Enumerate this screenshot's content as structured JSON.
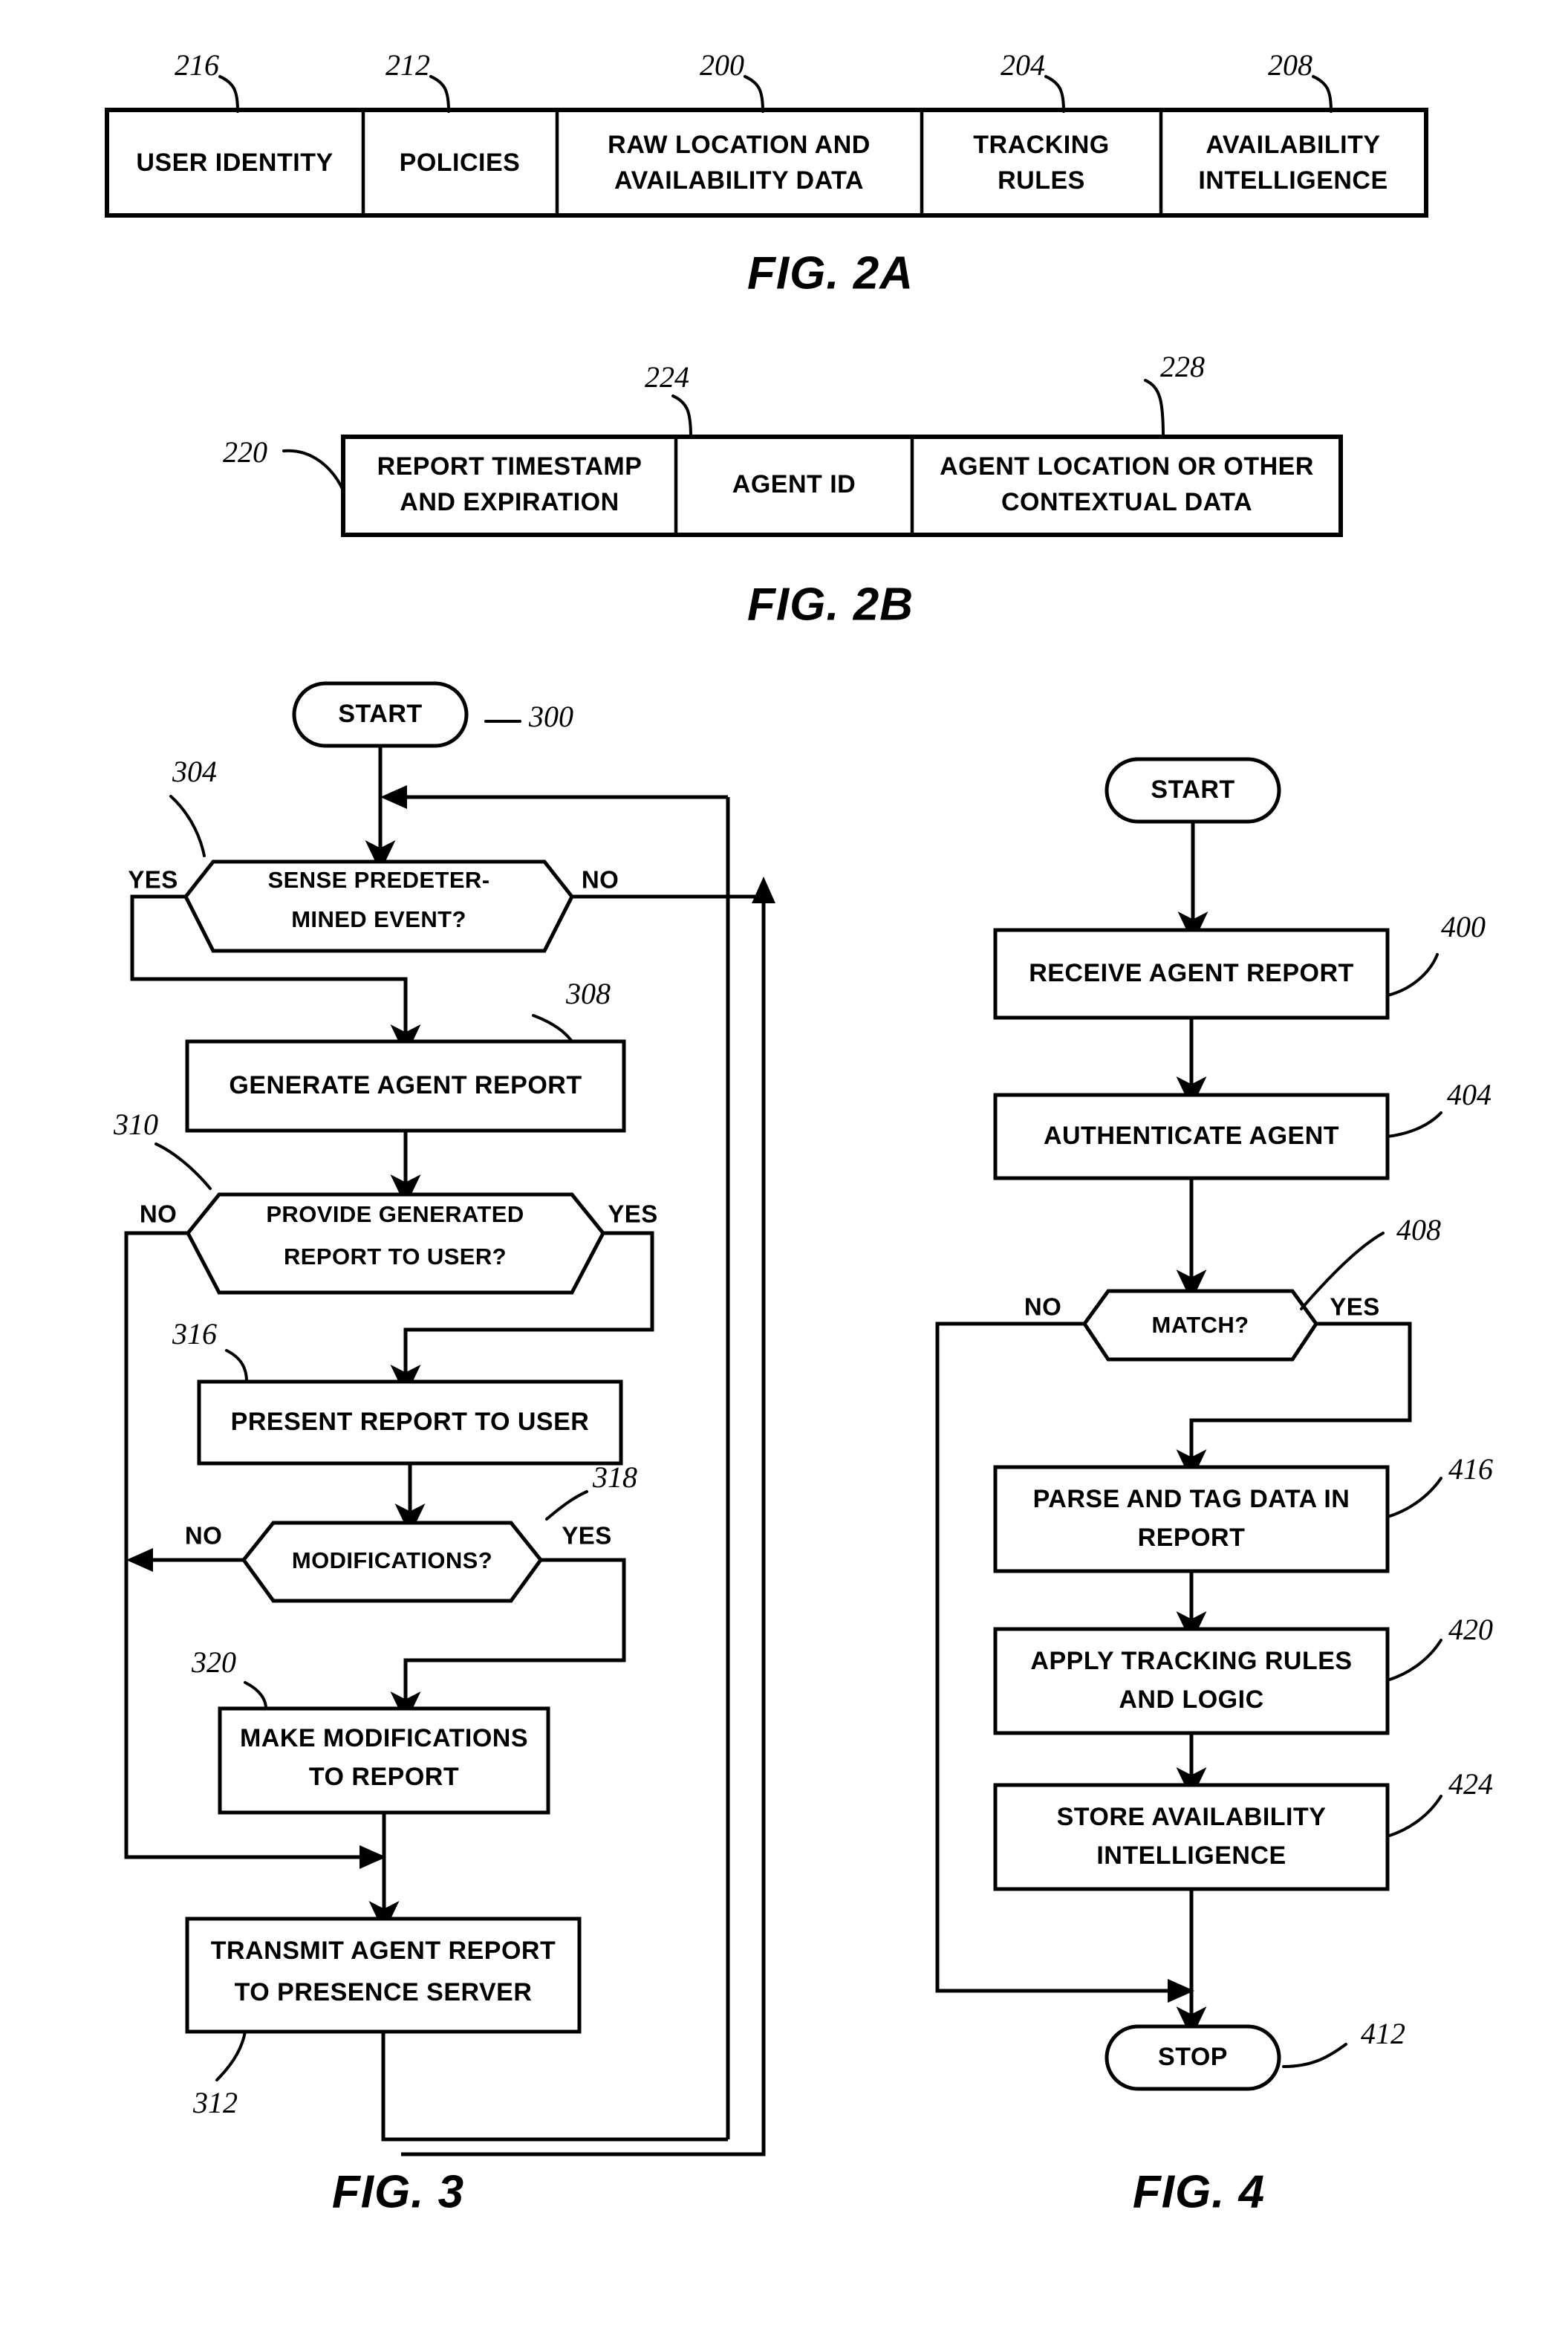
{
  "figures": {
    "fig2a": {
      "label": "FIG. 2A",
      "cells": [
        {
          "text": [
            "USER IDENTITY"
          ],
          "ref": "216"
        },
        {
          "text": [
            "POLICIES"
          ],
          "ref": "212"
        },
        {
          "text": [
            "RAW LOCATION AND",
            "AVAILABILITY DATA"
          ],
          "ref": "200"
        },
        {
          "text": [
            "TRACKING",
            "RULES"
          ],
          "ref": "204"
        },
        {
          "text": [
            "AVAILABILITY",
            "INTELLIGENCE"
          ],
          "ref": "208"
        }
      ]
    },
    "fig2b": {
      "label": "FIG. 2B",
      "row_ref": "220",
      "cells": [
        {
          "text": [
            "REPORT TIMESTAMP",
            "AND EXPIRATION"
          ],
          "ref": ""
        },
        {
          "text": [
            "AGENT ID"
          ],
          "ref": "224"
        },
        {
          "text": [
            "AGENT LOCATION OR OTHER",
            "CONTEXTUAL DATA"
          ],
          "ref": "228"
        }
      ]
    },
    "fig3": {
      "label": "FIG. 3",
      "nodes": [
        {
          "id": "start",
          "kind": "terminator",
          "text": [
            "START"
          ],
          "ref": "300"
        },
        {
          "id": "sense",
          "kind": "decision",
          "text": [
            "SENSE PREDETER-",
            "MINED EVENT?"
          ],
          "ref": "304",
          "yes": "YES",
          "no": "NO"
        },
        {
          "id": "generate",
          "kind": "process",
          "text": [
            "GENERATE AGENT REPORT"
          ],
          "ref": "308"
        },
        {
          "id": "provide",
          "kind": "decision",
          "text": [
            "PROVIDE GENERATED",
            "REPORT TO USER?"
          ],
          "ref": "310",
          "yes": "YES",
          "no": "NO"
        },
        {
          "id": "present",
          "kind": "process",
          "text": [
            "PRESENT REPORT TO USER"
          ],
          "ref": "316"
        },
        {
          "id": "modifications",
          "kind": "decision",
          "text": [
            "MODIFICATIONS?"
          ],
          "ref": "318",
          "yes": "YES",
          "no": "NO"
        },
        {
          "id": "make",
          "kind": "process",
          "text": [
            "MAKE MODIFICATIONS",
            "TO REPORT"
          ],
          "ref": "320"
        },
        {
          "id": "transmit",
          "kind": "process",
          "text": [
            "TRANSMIT AGENT REPORT",
            "TO PRESENCE SERVER"
          ],
          "ref": "312"
        }
      ]
    },
    "fig4": {
      "label": "FIG. 4",
      "nodes": [
        {
          "id": "start",
          "kind": "terminator",
          "text": [
            "START"
          ],
          "ref": ""
        },
        {
          "id": "receive",
          "kind": "process",
          "text": [
            "RECEIVE AGENT REPORT"
          ],
          "ref": "400"
        },
        {
          "id": "authenticate",
          "kind": "process",
          "text": [
            "AUTHENTICATE AGENT"
          ],
          "ref": "404"
        },
        {
          "id": "match",
          "kind": "decision",
          "text": [
            "MATCH?"
          ],
          "ref": "408",
          "yes": "YES",
          "no": "NO"
        },
        {
          "id": "parse",
          "kind": "process",
          "text": [
            "PARSE AND TAG DATA IN",
            "REPORT"
          ],
          "ref": "416"
        },
        {
          "id": "apply",
          "kind": "process",
          "text": [
            "APPLY TRACKING RULES",
            "AND LOGIC"
          ],
          "ref": "420"
        },
        {
          "id": "store",
          "kind": "process",
          "text": [
            "STORE AVAILABILITY",
            "INTELLIGENCE"
          ],
          "ref": "424"
        },
        {
          "id": "stop",
          "kind": "terminator",
          "text": [
            "STOP"
          ],
          "ref": "412"
        }
      ]
    }
  },
  "colors": {
    "ink": "#000000",
    "paper": "#ffffff"
  }
}
